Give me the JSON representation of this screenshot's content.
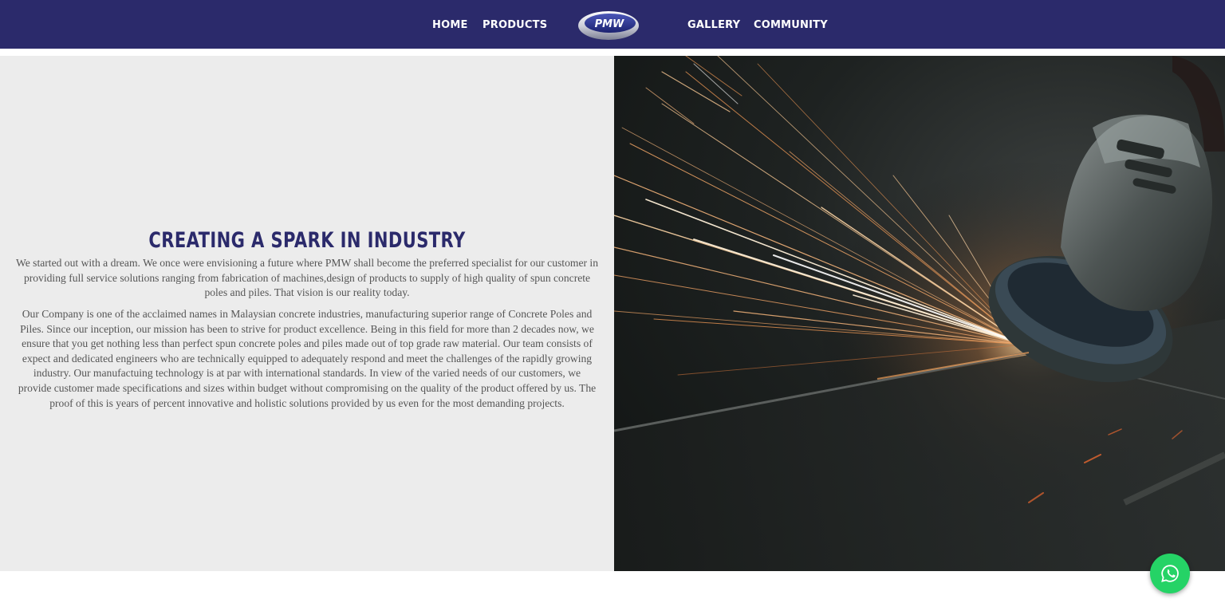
{
  "nav": {
    "links": [
      "HOME",
      "PRODUCTS",
      "GALLERY",
      "COMMUNITY"
    ],
    "logo_text": "PMW"
  },
  "about": {
    "headline": "CREATING A SPARK IN INDUSTRY",
    "paragraphs": [
      "We started out with a dream. We once were envisioning a future where PMW shall become the preferred specialist for our customer in providing full service solutions ranging from fabrication of machines,design of products to supply of high quality of spun concrete poles and piles. That vision is our reality today.",
      "Our Company is one of the acclaimed names in Malaysian concrete industries, manufacturing superior range of Concrete Poles and Piles. Since our inception, our mission has been to strive for product excellence. Being in this field for more than 2 decades now, we ensure that you get nothing less than perfect spun concrete poles and piles made out of top grade raw material. Our team consists of expect and dedicated engineers who are technically equipped to adequately respond and meet the challenges of the rapidly growing industry. Our manufactuing technology is at par with international standards. In view of the varied needs of our customers, we provide customer made specifications and sizes within budget without compromising on the quality of the product offered by us. The proof of this is years of percent innovative and holistic solutions provided by us even for the most demanding projects."
    ]
  },
  "hero_image": {
    "subject": "angle grinder throwing sparks"
  },
  "whatsapp": {
    "icon": "whatsapp-icon"
  },
  "colors": {
    "nav_bg": "#2b2a6b",
    "headline": "#2b2a6b",
    "panel_bg": "#ececec",
    "whatsapp": "#25d366"
  }
}
